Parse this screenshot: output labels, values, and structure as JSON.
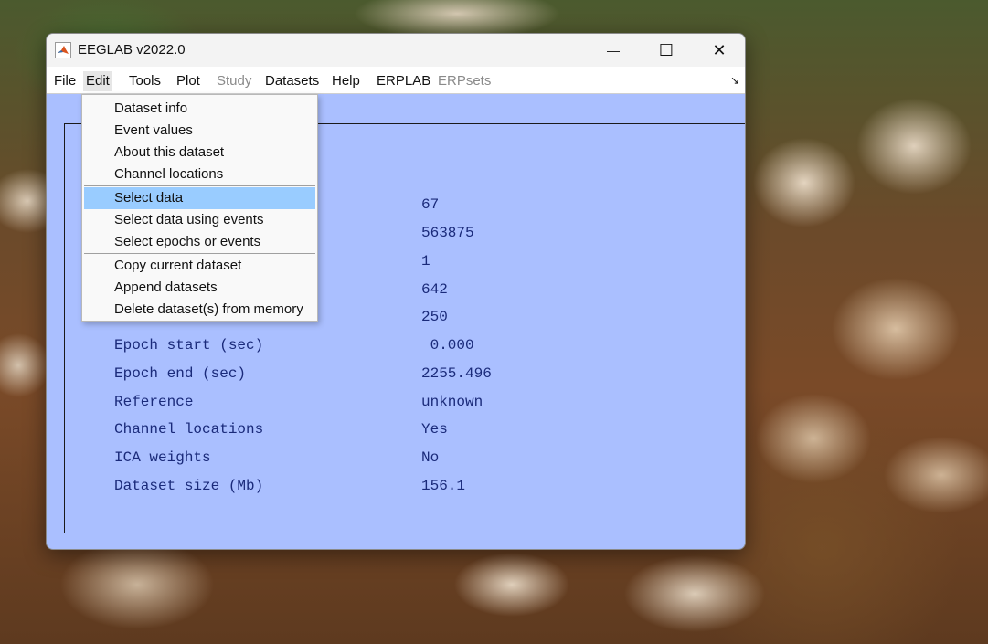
{
  "window": {
    "title": "EEGLAB v2022.0",
    "minimize_glyph": "—",
    "maximize_glyph": "☐",
    "close_glyph": "✕",
    "icon": "matlab-icon"
  },
  "menubar": {
    "items": [
      "File",
      "Edit",
      "Tools",
      "Plot",
      "Study",
      "Datasets",
      "Help",
      "ERPLAB",
      "ERPsets"
    ],
    "disabled": [
      "Study",
      "ERPsets"
    ],
    "open_menu": "Edit",
    "corner_glyph": "↘"
  },
  "edit_menu": {
    "groups": [
      [
        "Dataset info",
        "Event values",
        "About this dataset",
        "Channel locations"
      ],
      [
        "Select data",
        "Select data using events",
        "Select epochs or events"
      ],
      [
        "Copy current dataset",
        "Append datasets",
        "Delete dataset(s) from memory"
      ]
    ],
    "highlighted": "Select data",
    "highlight_color": "#99ccff"
  },
  "dataset_info": {
    "rows": [
      {
        "label": "",
        "value": "67"
      },
      {
        "label": "",
        "value": "563875"
      },
      {
        "label": "",
        "value": "1"
      },
      {
        "label": "",
        "value": "642"
      },
      {
        "label": "",
        "value": "250"
      },
      {
        "label": "Epoch start (sec)",
        "value": " 0.000"
      },
      {
        "label": "Epoch end (sec)",
        "value": "2255.496"
      },
      {
        "label": "Reference",
        "value": "unknown"
      },
      {
        "label": "Channel locations",
        "value": "Yes"
      },
      {
        "label": "ICA weights",
        "value": "No"
      },
      {
        "label": "Dataset size (Mb)",
        "value": "156.1"
      }
    ]
  },
  "colors": {
    "window_bg": "#aabfff",
    "info_text": "#1a2a7a"
  }
}
